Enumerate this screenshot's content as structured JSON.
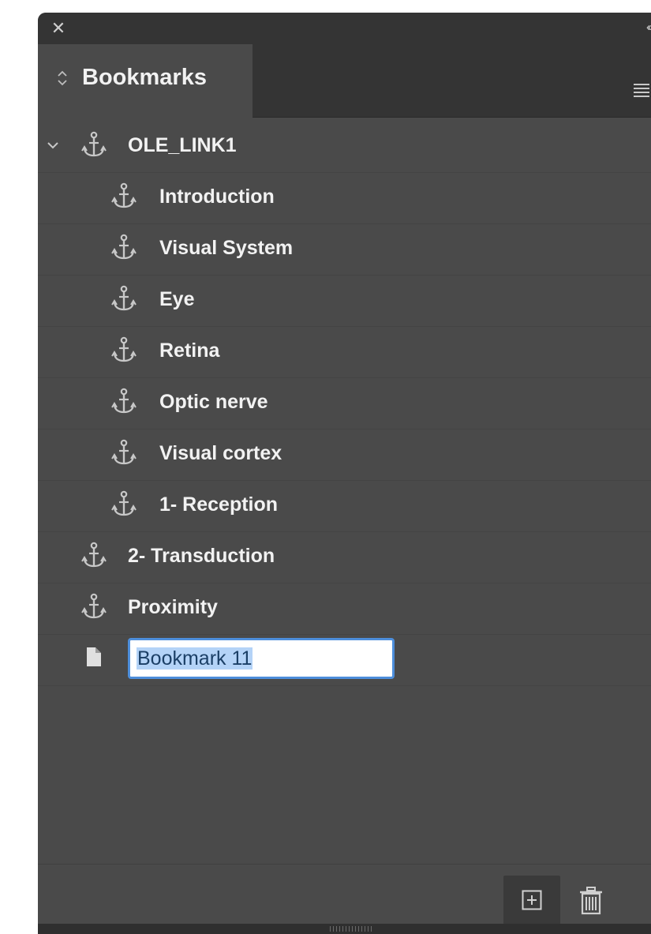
{
  "panel": {
    "tab_label": "Bookmarks",
    "icons": {
      "close": "close-icon",
      "collapse": "double-chevron-left-icon",
      "tab_arrows": "up-down-arrows-icon",
      "menu": "panel-menu-icon"
    }
  },
  "tree": {
    "root": {
      "label": "OLE_LINK1",
      "expanded": true
    },
    "children": [
      {
        "label": "Introduction"
      },
      {
        "label": "Visual System"
      },
      {
        "label": "Eye"
      },
      {
        "label": "Retina"
      },
      {
        "label": "Optic nerve"
      },
      {
        "label": "Visual cortex"
      },
      {
        "label": "1- Reception"
      }
    ],
    "top_level": [
      {
        "label": "2- Transduction"
      },
      {
        "label": "Proximity"
      }
    ],
    "editing": {
      "value": "Bookmark 11"
    }
  },
  "footer": {
    "new_button_icon": "new-bookmark-icon",
    "delete_button_icon": "trash-icon"
  },
  "colors": {
    "panel_bg": "#4a4a4a",
    "header_bg": "#343434",
    "text": "#f2f2f2",
    "icon": "#c8c8c8",
    "focus_ring": "#4d8edb",
    "selection": "#b4d3f7"
  }
}
